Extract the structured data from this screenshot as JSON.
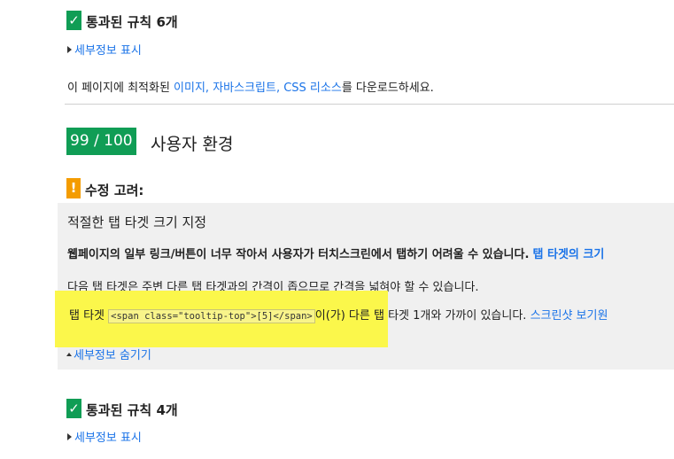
{
  "passed_rules_top": {
    "check_glyph": "✓",
    "title": "통과된 규칙 6개",
    "toggle_label": "세부정보 표시"
  },
  "optimize_text": {
    "prefix": "이 페이지에 최적화된 ",
    "link": "이미지, 자바스크립트, CSS 리소스",
    "suffix": "를 다운로드하세요."
  },
  "ux_section": {
    "score": "99 / 100",
    "title": "사용자 환경"
  },
  "consider_fixing": {
    "warn_glyph": "!",
    "title": "수정 고려:",
    "rule_title": "적절한 탭 타겟 크기 지정",
    "summary_bold": "웹페이지의 일부 링크/버튼이 너무 작아서 사용자가 터치스크린에서 탭하기 어려울 수 있습니다.",
    "summary_link": "탭 타겟의 크기",
    "detail_text": "다음 탭 타겟은 주변 다른 탭 타겟과의 간격이 좁으므로 간격을 넓혀야 할 수 있습니다.",
    "item_prefix": "탭 타겟",
    "item_code": "<span class=\"tooltip-top\">[5]</span>",
    "item_middle": "이(가) 다른 탭 타겟 1개와 가까이 있습니다.",
    "item_link": "스크린샷 보기원",
    "toggle_label": "세부정보 숨기기"
  },
  "passed_rules_bottom": {
    "check_glyph": "✓",
    "title": "통과된 규칙 4개",
    "toggle_label": "세부정보 표시"
  },
  "colors": {
    "pass_green": "#109d55",
    "warn_orange": "#f49c00",
    "link_blue": "#1a73e8",
    "highlight_yellow": "#fbf74b",
    "panel_gray": "#f0f0f0"
  }
}
